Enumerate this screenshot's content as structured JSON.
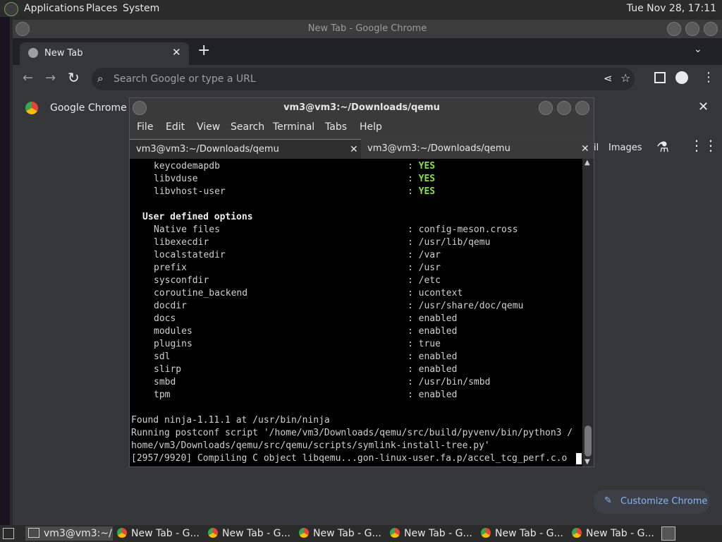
{
  "topbar": {
    "menus": [
      "Applications",
      "Places",
      "System"
    ],
    "clock": "Tue Nov 28, 17:11"
  },
  "chrome": {
    "window_title": "New Tab - Google Chrome",
    "tab_label": "New Tab",
    "omnibox_placeholder": "Search Google or type a URL",
    "infobar_text": "Google Chrome is",
    "header_links": [
      "il",
      "Images"
    ],
    "customize_label": "Customize Chrome"
  },
  "terminal": {
    "title": "vm3@vm3:~/Downloads/qemu",
    "menu": [
      "File",
      "Edit",
      "View",
      "Search",
      "Terminal",
      "Tabs",
      "Help"
    ],
    "tabs": [
      "vm3@vm3:~/Downloads/qemu",
      "vm3@vm3:~/Downloads/qemu"
    ],
    "options_top": [
      {
        "key": "keycodemapdb",
        "value": "YES"
      },
      {
        "key": "libvduse",
        "value": "YES"
      },
      {
        "key": "libvhost-user",
        "value": "YES"
      }
    ],
    "section_heading": "User defined options",
    "options": [
      {
        "key": "Native files",
        "value": "config-meson.cross"
      },
      {
        "key": "libexecdir",
        "value": "/usr/lib/qemu"
      },
      {
        "key": "localstatedir",
        "value": "/var"
      },
      {
        "key": "prefix",
        "value": "/usr"
      },
      {
        "key": "sysconfdir",
        "value": "/etc"
      },
      {
        "key": "coroutine_backend",
        "value": "ucontext"
      },
      {
        "key": "docdir",
        "value": "/usr/share/doc/qemu"
      },
      {
        "key": "docs",
        "value": "enabled"
      },
      {
        "key": "modules",
        "value": "enabled"
      },
      {
        "key": "plugins",
        "value": "true"
      },
      {
        "key": "sdl",
        "value": "enabled"
      },
      {
        "key": "slirp",
        "value": "enabled"
      },
      {
        "key": "smbd",
        "value": "/usr/bin/smbd"
      },
      {
        "key": "tpm",
        "value": "enabled"
      }
    ],
    "output": [
      "Found ninja-1.11.1 at /usr/bin/ninja",
      "Running postconf script '/home/vm3/Downloads/qemu/src/build/pyvenv/bin/python3 /",
      "home/vm3/Downloads/qemu/src/qemu/scripts/symlink-install-tree.py'",
      "[2957/9920] Compiling C object libqemu...gon-linux-user.fa.p/accel_tcg_perf.c.o"
    ]
  },
  "taskbar": {
    "items": [
      "vm3@vm3:~/...",
      "New Tab - G...",
      "New Tab - G...",
      "New Tab - G...",
      "New Tab - G...",
      "New Tab - G...",
      "New Tab - G..."
    ]
  }
}
